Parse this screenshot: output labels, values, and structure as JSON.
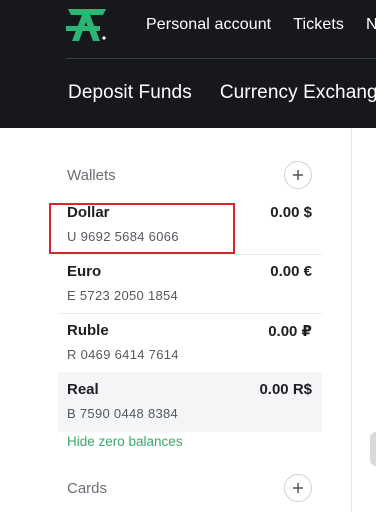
{
  "header": {
    "top_nav": [
      "Personal account",
      "Tickets",
      "N"
    ],
    "main_nav": [
      "Deposit Funds",
      "Currency Exchange"
    ]
  },
  "colors": {
    "header_bg": "#16181c",
    "logo_green": "#2bb673",
    "link_green": "#3aa86b",
    "highlight_red": "#d6262e"
  },
  "wallets_section": {
    "title": "Wallets",
    "add_icon": "plus-icon",
    "items": [
      {
        "name": "Dollar",
        "number": "U 9692 5684 6066",
        "balance": "0.00 $"
      },
      {
        "name": "Euro",
        "number": "E 5723 2050 1854",
        "balance": "0.00 €"
      },
      {
        "name": "Ruble",
        "number": "R 0469 6414 7614",
        "balance": "0.00 ₽"
      },
      {
        "name": "Real",
        "number": "B 7590 0448 8384",
        "balance": "0.00 R$"
      }
    ],
    "hide_zero_label": "Hide zero balances"
  },
  "cards_section": {
    "title": "Cards",
    "add_icon": "plus-icon"
  }
}
